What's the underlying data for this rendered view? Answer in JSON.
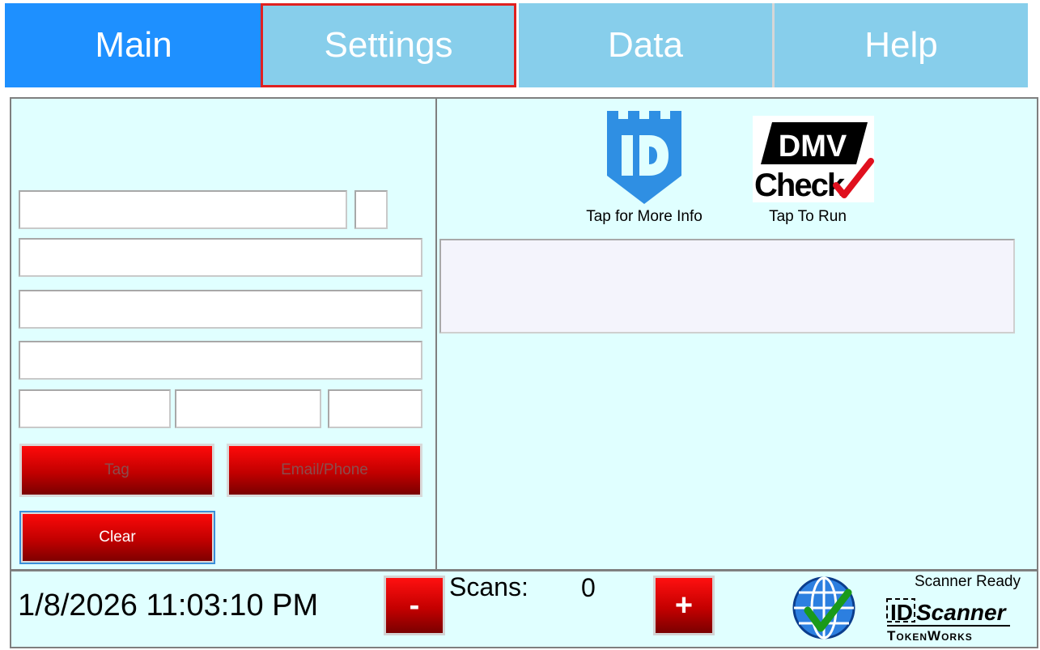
{
  "tabs": [
    {
      "label": "Main",
      "active": true
    },
    {
      "label": "Settings",
      "focused": true
    },
    {
      "label": "Data"
    },
    {
      "label": "Help"
    }
  ],
  "left_panel": {
    "buttons": {
      "tag_label": "Tag",
      "email_phone_label": "Email/Phone",
      "clear_label": "Clear"
    }
  },
  "right_panel": {
    "id_logo_caption": "Tap for More Info",
    "dmv_logo_caption": "Tap To Run",
    "dmv_logo_text_top": "DMV",
    "dmv_logo_text_bottom": "Check"
  },
  "status_bar": {
    "datetime": "1/8/2026 11:03:10 PM",
    "minus_label": "-",
    "plus_label": "+",
    "scans_label": "Scans:",
    "scans_count": "0",
    "scanner_status": "Scanner Ready",
    "brand_top": "Scanner",
    "brand_bottom": "TokenWorks"
  },
  "colors": {
    "tab_inactive": "#87ceeb",
    "tab_active": "#1e90ff",
    "focus_outline": "#e02020",
    "panel_bg": "#e0ffff",
    "button_red": "#c10000",
    "id_logo_blue": "#2f8fe3",
    "check_green": "#1a9a1a"
  }
}
